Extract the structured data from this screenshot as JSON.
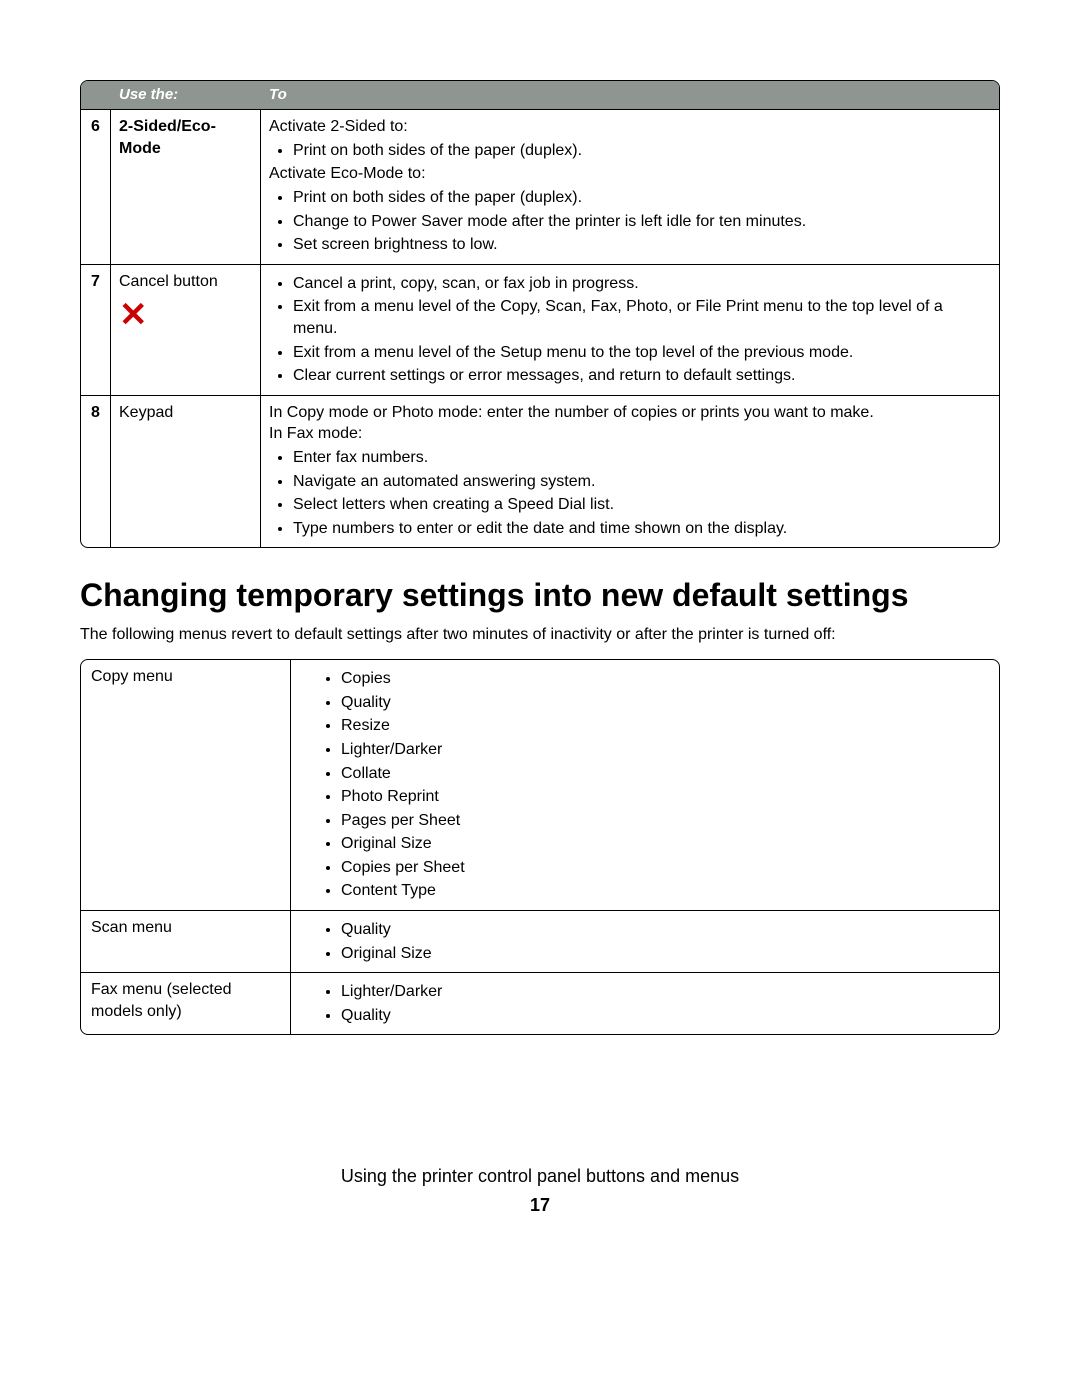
{
  "table1": {
    "header": {
      "col1": "",
      "col2": "Use the:",
      "col3": "To"
    },
    "rows": [
      {
        "num": "6",
        "use_label": "2-Sided/Eco-Mode",
        "use_bold": true,
        "to": {
          "line1": "Activate 2-Sided to:",
          "bullets1": [
            "Print on both sides of the paper (duplex)."
          ],
          "line2": "Activate Eco-Mode to:",
          "bullets2": [
            "Print on both sides of the paper (duplex).",
            "Change to Power Saver mode after the printer is left idle for ten minutes.",
            "Set screen brightness to low."
          ]
        }
      },
      {
        "num": "7",
        "use_label": "Cancel button",
        "icon": "✕",
        "to": {
          "bullets": [
            "Cancel a print, copy, scan, or fax job in progress.",
            "Exit from a menu level of the Copy, Scan, Fax, Photo, or File Print menu to the top level of a menu.",
            "Exit from a menu level of the Setup menu to the top level of the previous mode.",
            "Clear current settings or error messages, and return to default settings."
          ]
        }
      },
      {
        "num": "8",
        "use_label": "Keypad",
        "to": {
          "line1": "In Copy mode or Photo mode: enter the number of copies or prints you want to make.",
          "line2": "In Fax mode:",
          "bullets": [
            "Enter fax numbers.",
            "Navigate an automated answering system.",
            "Select letters when creating a Speed Dial list.",
            "Type numbers to enter or edit the date and time shown on the display."
          ]
        }
      }
    ]
  },
  "heading": "Changing temporary settings into new default settings",
  "intro": "The following menus revert to default settings after two minutes of inactivity or after the printer is turned off:",
  "table2": {
    "rows": [
      {
        "menu": "Copy menu",
        "items": [
          "Copies",
          "Quality",
          "Resize",
          "Lighter/Darker",
          "Collate",
          "Photo Reprint",
          "Pages per Sheet",
          "Original Size",
          "Copies per Sheet",
          "Content Type"
        ]
      },
      {
        "menu": "Scan menu",
        "items": [
          "Quality",
          "Original Size"
        ]
      },
      {
        "menu": "Fax menu (selected models only)",
        "items": [
          "Lighter/Darker",
          "Quality"
        ]
      }
    ]
  },
  "footer": {
    "title": "Using the printer control panel buttons and menus",
    "page": "17"
  }
}
